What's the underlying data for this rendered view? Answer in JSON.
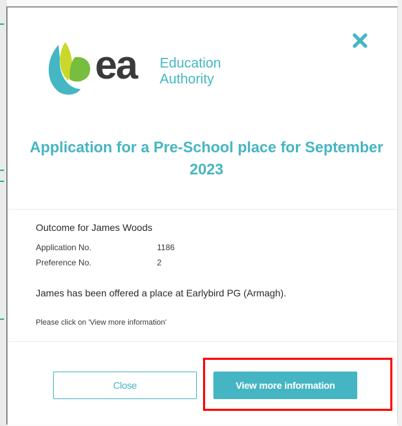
{
  "brand": {
    "logo_mark": "ea",
    "name_line1": "Education",
    "name_line2": "Authority",
    "accent_color": "#45b5c3"
  },
  "dialog": {
    "title": "Application for a Pre-School place for September 2023",
    "close_icon": "close-icon"
  },
  "outcome": {
    "heading": "Outcome for James Woods",
    "details": [
      {
        "label": "Application No.",
        "value": "1186"
      },
      {
        "label": "Preference No.",
        "value": "2"
      }
    ],
    "offer_text": "James has been offered a place at Earlybird PG (Armagh).",
    "instruction": "Please click on 'View more information'"
  },
  "actions": {
    "close_label": "Close",
    "more_label": "View more information"
  },
  "annotation": {
    "highlight_color": "#ff0000"
  }
}
